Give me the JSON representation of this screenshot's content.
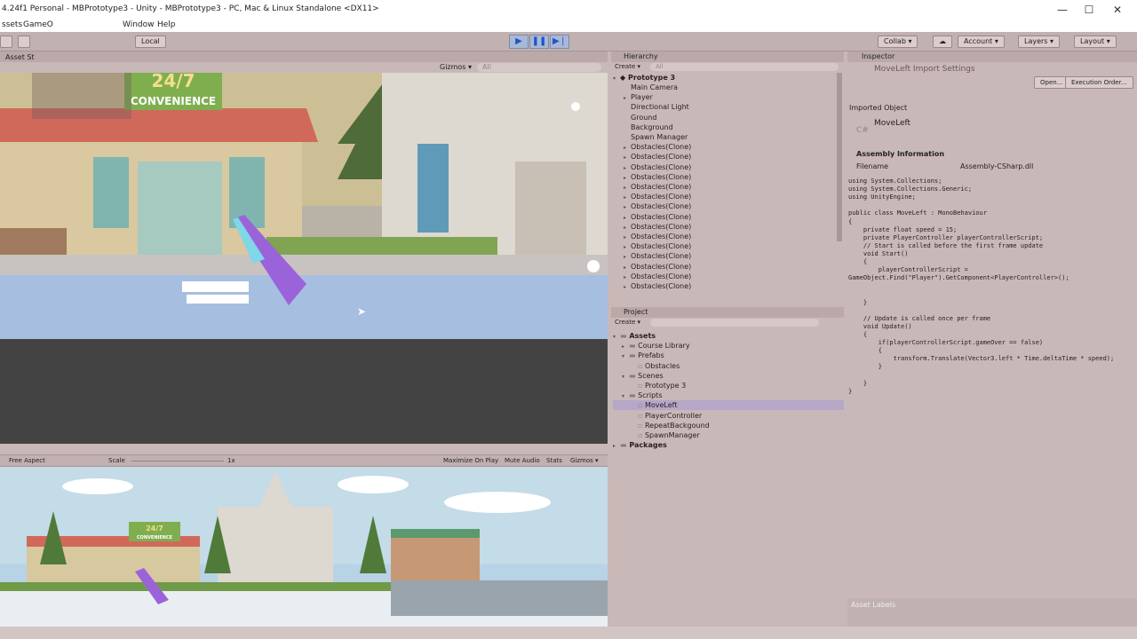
{
  "window": {
    "title": "4.24f1 Personal - MBPrototype3 - Unity - MBPrototype3 - PC, Mac & Linux Standalone <DX11>",
    "minimize": "—",
    "maximize": "☐",
    "close": "✕"
  },
  "menu": [
    "ssets",
    "GameO",
    "Window",
    "Help"
  ],
  "toolbar": {
    "local": "Local",
    "collab": "Collab ▾",
    "account": "Account ▾",
    "layers": "Layers ▾",
    "layout": "Layout ▾"
  },
  "scene": {
    "tab": "Asset St",
    "gizmos": "Gizmos ▾",
    "search": "All",
    "sign_line1": "24/7",
    "sign_line2": "CONVENIENCE"
  },
  "game": {
    "aspect": "Free Aspect",
    "scale_label": "Scale",
    "scale_value": "1x",
    "maximize": "Maximize On Play",
    "mute": "Mute Audio",
    "stats": "Stats",
    "gizmos": "Gizmos ▾",
    "sign_line1": "24/7",
    "sign_line2": "CONVENIENCE"
  },
  "hierarchy": {
    "tab": "Hierarchy",
    "create": "Create ▾",
    "search": "All",
    "scene_name": "Prototype 3",
    "items": [
      {
        "label": "Main Camera",
        "expand": ""
      },
      {
        "label": "Player",
        "expand": "▸"
      },
      {
        "label": "Directional Light",
        "expand": ""
      },
      {
        "label": "Ground",
        "expand": ""
      },
      {
        "label": "Background",
        "expand": ""
      },
      {
        "label": "Spawn Manager",
        "expand": ""
      },
      {
        "label": "Obstacles(Clone)",
        "expand": "▸"
      },
      {
        "label": "Obstacles(Clone)",
        "expand": "▸"
      },
      {
        "label": "Obstacles(Clone)",
        "expand": "▸"
      },
      {
        "label": "Obstacles(Clone)",
        "expand": "▸"
      },
      {
        "label": "Obstacles(Clone)",
        "expand": "▸"
      },
      {
        "label": "Obstacles(Clone)",
        "expand": "▸"
      },
      {
        "label": "Obstacles(Clone)",
        "expand": "▸"
      },
      {
        "label": "Obstacles(Clone)",
        "expand": "▸"
      },
      {
        "label": "Obstacles(Clone)",
        "expand": "▸"
      },
      {
        "label": "Obstacles(Clone)",
        "expand": "▸"
      },
      {
        "label": "Obstacles(Clone)",
        "expand": "▸"
      },
      {
        "label": "Obstacles(Clone)",
        "expand": "▸"
      },
      {
        "label": "Obstacles(Clone)",
        "expand": "▸"
      },
      {
        "label": "Obstacles(Clone)",
        "expand": "▸"
      },
      {
        "label": "Obstacles(Clone)",
        "expand": "▸"
      }
    ]
  },
  "project": {
    "tab": "Project",
    "create": "Create ▾",
    "tree": [
      {
        "label": "Assets",
        "indent": 0,
        "expand": "▾",
        "folder": true,
        "bold": true
      },
      {
        "label": "Course Library",
        "indent": 1,
        "expand": "▸",
        "folder": true
      },
      {
        "label": "Prefabs",
        "indent": 1,
        "expand": "▾",
        "folder": true
      },
      {
        "label": "Obstacles",
        "indent": 2,
        "expand": "",
        "folder": false
      },
      {
        "label": "Scenes",
        "indent": 1,
        "expand": "▾",
        "folder": true
      },
      {
        "label": "Prototype 3",
        "indent": 2,
        "expand": "",
        "folder": false
      },
      {
        "label": "Scripts",
        "indent": 1,
        "expand": "▾",
        "folder": true
      },
      {
        "label": "MoveLeft",
        "indent": 2,
        "expand": "",
        "folder": false,
        "selected": true
      },
      {
        "label": "PlayerController",
        "indent": 2,
        "expand": "",
        "folder": false
      },
      {
        "label": "RepeatBackgound",
        "indent": 2,
        "expand": "",
        "folder": false
      },
      {
        "label": "SpawnManager",
        "indent": 2,
        "expand": "",
        "folder": false
      },
      {
        "label": "Packages",
        "indent": 0,
        "expand": "▸",
        "folder": true,
        "bold": true
      }
    ]
  },
  "inspector": {
    "tab": "Inspector",
    "title": "MoveLeft Import Settings",
    "open_button": "Open...",
    "exec_button": "Execution Order...",
    "imported_object": "Imported Object",
    "object_name": "MoveLeft",
    "assembly_header": "Assembly Information",
    "filename_label": "Filename",
    "filename_value": "Assembly-CSharp.dll",
    "asset_labels": "Asset Labels",
    "code": [
      "using System.Collections;",
      "using System.Collections.Generic;",
      "using UnityEngine;",
      "",
      "public class MoveLeft : MonoBehaviour",
      "{",
      "    private float speed = 15;",
      "    private PlayerController playerControllerScript;",
      "    // Start is called before the first frame update",
      "    void Start()",
      "    {",
      "        playerControllerScript =",
      "GameObject.Find(\"Player\").GetComponent<PlayerController>();",
      "",
      "",
      "    }",
      "",
      "    // Update is called once per frame",
      "    void Update()",
      "    {",
      "        if(playerControllerScript.gameOver == false)",
      "        {",
      "            transform.Translate(Vector3.left * Time.deltaTime * speed);",
      "        }",
      "",
      "    }",
      "}"
    ]
  }
}
